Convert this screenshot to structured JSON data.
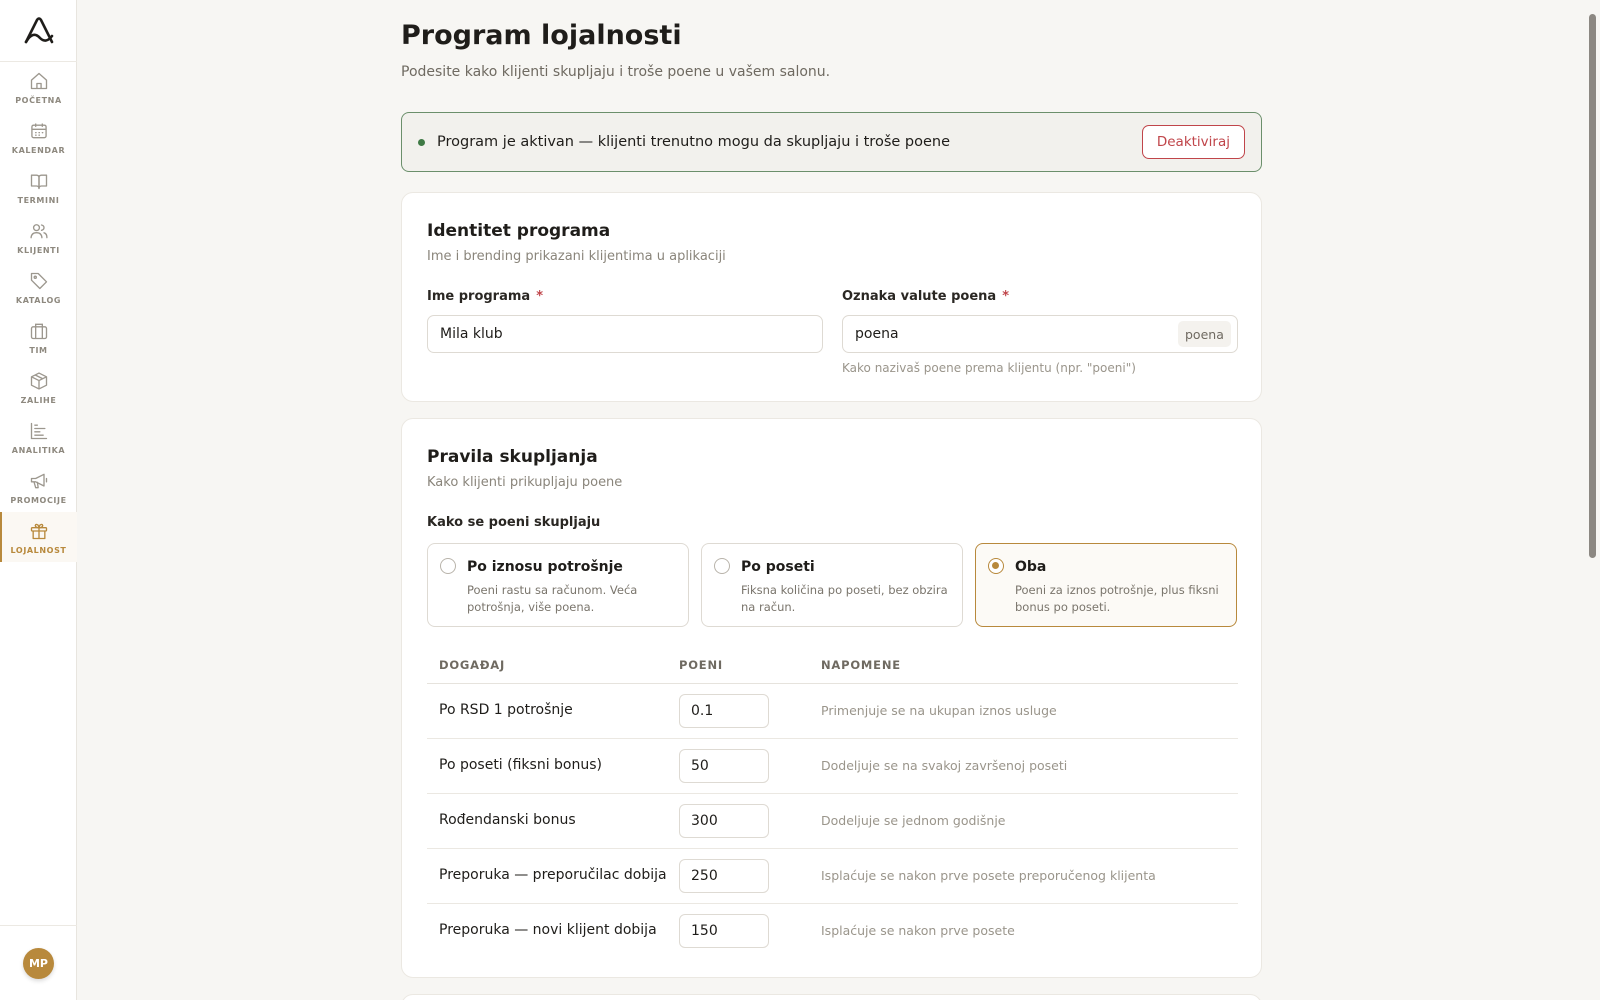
{
  "sidebar": {
    "logo_icon": "brand-logo-icon",
    "items": [
      {
        "label": "POČETNA",
        "icon": "home-icon"
      },
      {
        "label": "KALENDAR",
        "icon": "calendar-icon"
      },
      {
        "label": "TERMINI",
        "icon": "book-icon"
      },
      {
        "label": "KLIJENTI",
        "icon": "users-icon"
      },
      {
        "label": "KATALOG",
        "icon": "tag-icon"
      },
      {
        "label": "TIM",
        "icon": "briefcase-icon"
      },
      {
        "label": "ZALIHE",
        "icon": "box-icon"
      },
      {
        "label": "ANALITIKA",
        "icon": "chart-icon"
      },
      {
        "label": "PROMOCIJE",
        "icon": "megaphone-icon"
      },
      {
        "label": "LOJALNOST",
        "icon": "gift-icon"
      }
    ],
    "active_item": "LOJALNOST",
    "avatar_initials": "MP"
  },
  "page": {
    "title": "Program lojalnosti",
    "subtitle": "Podesite kako klijenti skupljaju i troše poene u vašem salonu."
  },
  "banner": {
    "text": "Program je aktivan — klijenti trenutno mogu da skupljaju i troše poene",
    "button_label": "Deaktiviraj"
  },
  "identity": {
    "title": "Identitet programa",
    "subtitle": "Ime i brending prikazani klijentima u aplikaciji",
    "name_label": "Ime programa",
    "name_value": "Mila klub",
    "currency_label": "Oznaka valute poena",
    "currency_value": "poena",
    "currency_suffix": "poena",
    "currency_hint": "Kako nazivaš poene prema klijentu (npr. \"poeni\")",
    "required_mark": "*"
  },
  "earning": {
    "title": "Pravila skupljanja",
    "subtitle": "Kako klijenti prikupljaju poene",
    "method_label": "Kako se poeni skupljaju",
    "options": [
      {
        "title": "Po iznosu potrošnje",
        "desc": "Poeni rastu sa računom. Veća potrošnja, više poena.",
        "selected": false
      },
      {
        "title": "Po poseti",
        "desc": "Fiksna količina po poseti, bez obzira na račun.",
        "selected": false
      },
      {
        "title": "Oba",
        "desc": "Poeni za iznos potrošnje, plus fiksni bonus po poseti.",
        "selected": true
      }
    ],
    "table": {
      "headers": [
        "DOGAĐAJ",
        "POENI",
        "NAPOMENE"
      ],
      "rows": [
        {
          "event": "Po RSD 1 potrošnje",
          "points": "0.1",
          "note": "Primenjuje se na ukupan iznos usluge"
        },
        {
          "event": "Po poseti (fiksni bonus)",
          "points": "50",
          "note": "Dodeljuje se na svakoj završenoj poseti"
        },
        {
          "event": "Rođendanski bonus",
          "points": "300",
          "note": "Dodeljuje se jednom godišnje"
        },
        {
          "event": "Preporuka — preporučilac dobija",
          "points": "250",
          "note": "Isplaćuje se nakon prve posete preporučenog klijenta"
        },
        {
          "event": "Preporuka — novi klijent dobija",
          "points": "150",
          "note": "Isplaćuje se nakon prve posete"
        }
      ]
    }
  },
  "colors": {
    "accent": "#b8893c",
    "active_green": "#3f7a45",
    "danger": "#c0454a"
  }
}
